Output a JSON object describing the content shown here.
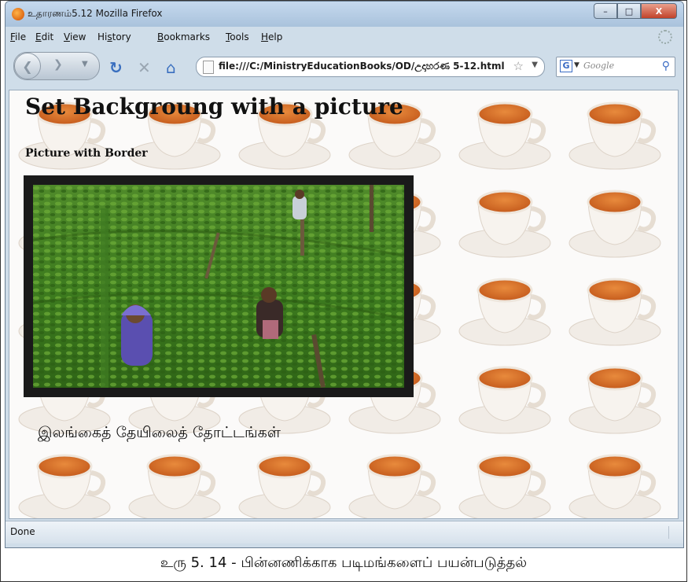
{
  "window": {
    "title": "உதாரணம்5.12 Mozilla Firefox",
    "controls": {
      "minimize": "–",
      "maximize": "□",
      "close": "X"
    }
  },
  "menubar": {
    "items": [
      {
        "label": "File",
        "accel": "F",
        "rest": "ile"
      },
      {
        "label": "Edit",
        "accel": "E",
        "rest": "dit"
      },
      {
        "label": "View",
        "accel": "V",
        "rest": "iew"
      },
      {
        "label": "History",
        "accel": "s",
        "pre": "Hi",
        "rest": "tory"
      },
      {
        "label": "Bookmarks",
        "accel": "B",
        "rest": "ookmarks"
      },
      {
        "label": "Tools",
        "accel": "T",
        "rest": "ools"
      },
      {
        "label": "Help",
        "accel": "H",
        "rest": "elp"
      }
    ]
  },
  "navbar": {
    "icons": [
      "back-arrow-icon",
      "forward-arrow-icon",
      "reload-icon",
      "stop-icon",
      "home-icon"
    ],
    "url": "file:///C:/MinistryEducationBooks/OD/උදාහරණ 5-12.html",
    "search_engine": "G",
    "search_placeholder": "Google"
  },
  "page": {
    "heading": "Set Backgroung with a picture",
    "subheading": "Picture with Border",
    "caption": "இலங்கைத் தேயிலைத் தோட்டங்கள்",
    "border_color": "#1a1a1a"
  },
  "statusbar": {
    "text": "Done"
  },
  "figure": {
    "caption": "உரு 5. 14 - பின்னணிக்காக படிமங்களைப் பயன்படுத்தல்"
  }
}
